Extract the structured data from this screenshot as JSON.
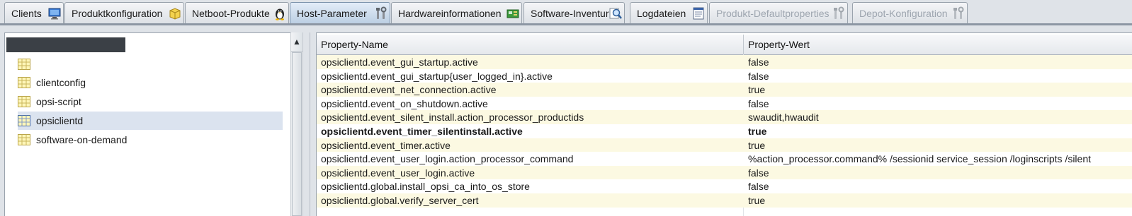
{
  "tabs": [
    {
      "label": "Clients",
      "icon": "monitor-icon",
      "state": "normal"
    },
    {
      "label": "Produktkonfiguration",
      "icon": "package-icon",
      "state": "normal"
    },
    {
      "label": "Netboot-Produkte",
      "icon": "penguin-icon",
      "state": "normal"
    },
    {
      "label": "Host-Parameter",
      "icon": "tools-icon",
      "state": "active"
    },
    {
      "label": "Hardwareinformationen",
      "icon": "hardware-icon",
      "state": "normal"
    },
    {
      "label": "Software-Inventur",
      "icon": "magnifier-icon",
      "state": "normal"
    },
    {
      "label": "Logdateien",
      "icon": "document-icon",
      "state": "normal"
    },
    {
      "label": "Produkt-Defaultproperties",
      "icon": "tools-icon",
      "state": "disabled"
    },
    {
      "label": "Depot-Konfiguration",
      "icon": "tools-icon",
      "state": "disabled"
    }
  ],
  "tree": {
    "root_label": "",
    "items": [
      {
        "label": "",
        "icon": "table-icon",
        "selected": false
      },
      {
        "label": "clientconfig",
        "icon": "table-icon",
        "selected": false
      },
      {
        "label": "opsi-script",
        "icon": "table-icon",
        "selected": false
      },
      {
        "label": "opsiclientd",
        "icon": "table-icon",
        "selected": true
      },
      {
        "label": "software-on-demand",
        "icon": "table-icon",
        "selected": false
      }
    ]
  },
  "table": {
    "headers": {
      "name": "Property-Name",
      "value": "Property-Wert"
    },
    "rows": [
      {
        "name": "opsiclientd.event_gui_startup.active",
        "value": "false",
        "bold": false
      },
      {
        "name": "opsiclientd.event_gui_startup{user_logged_in}.active",
        "value": "false",
        "bold": false
      },
      {
        "name": "opsiclientd.event_net_connection.active",
        "value": "true",
        "bold": false
      },
      {
        "name": "opsiclientd.event_on_shutdown.active",
        "value": "false",
        "bold": false
      },
      {
        "name": "opsiclientd.event_silent_install.action_processor_productids",
        "value": "swaudit,hwaudit",
        "bold": false
      },
      {
        "name": "opsiclientd.event_timer_silentinstall.active",
        "value": "true",
        "bold": true
      },
      {
        "name": "opsiclientd.event_timer.active",
        "value": "true",
        "bold": false
      },
      {
        "name": "opsiclientd.event_user_login.action_processor_command",
        "value": "%action_processor.command% /sessionid service_session /loginscripts /silent",
        "bold": false
      },
      {
        "name": "opsiclientd.event_user_login.active",
        "value": "false",
        "bold": false
      },
      {
        "name": "opsiclientd.global.install_opsi_ca_into_os_store",
        "value": "false",
        "bold": false
      },
      {
        "name": "opsiclientd.global.verify_server_cert",
        "value": "true",
        "bold": false
      }
    ]
  },
  "colors": {
    "row_alt": "#fcf9e2",
    "selected": "#dbe3ef",
    "active_tab": "#bccfe3",
    "disabled_text": "#9ea6b0"
  }
}
